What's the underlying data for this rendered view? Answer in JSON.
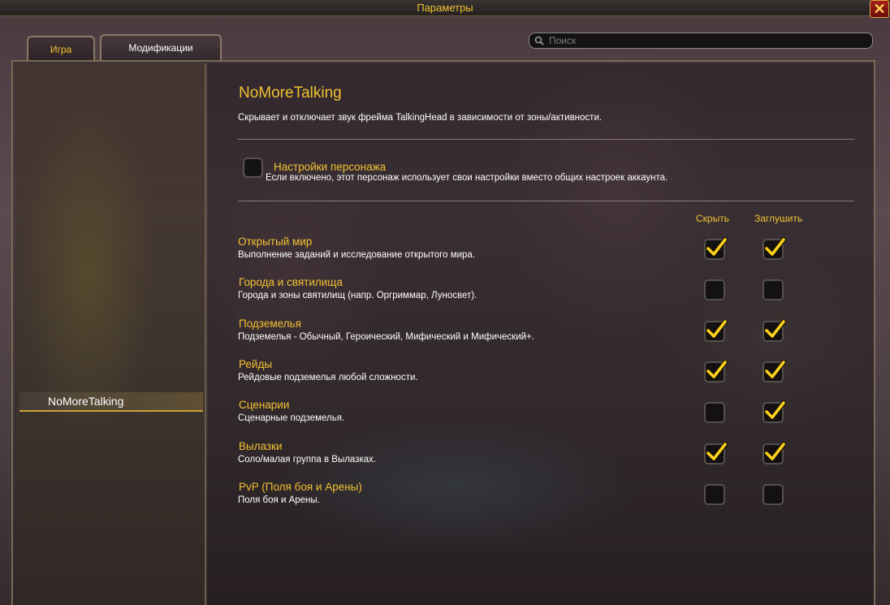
{
  "window": {
    "title": "Параметры",
    "close_label": "✕"
  },
  "tabs": [
    {
      "label": "Игра",
      "active": false
    },
    {
      "label": "Модификации",
      "active": true
    }
  ],
  "search": {
    "placeholder": "Поиск",
    "value": ""
  },
  "sidebar": {
    "items": [
      {
        "label": "NoMoreTalking",
        "selected": true
      }
    ]
  },
  "addon": {
    "title": "NoMoreTalking",
    "description": "Скрывает и отключает звук фрейма TalkingHead в зависимости от зоны/активности.",
    "character_settings": {
      "label": "Настройки персонажа",
      "description": "Если включено, этот персонаж использует свои настройки вместо общих настроек аккаунта.",
      "checked": false
    },
    "columns": {
      "hide": "Скрыть",
      "mute": "Заглушить"
    },
    "rows": [
      {
        "title": "Открытый мир",
        "description": "Выполнение заданий и исследование открытого мира.",
        "hide": true,
        "mute": true
      },
      {
        "title": "Города и святилища",
        "description": "Города и зоны святилищ (напр. Оргриммар, Луносвет).",
        "hide": false,
        "mute": false
      },
      {
        "title": "Подземелья",
        "description": "Подземелья - Обычный, Героический, Мифический и Мифический+.",
        "hide": true,
        "mute": true
      },
      {
        "title": "Рейды",
        "description": "Рейдовые подземелья любой сложности.",
        "hide": true,
        "mute": true
      },
      {
        "title": "Сценарии",
        "description": "Сценарные подземелья.",
        "hide": false,
        "mute": true
      },
      {
        "title": "Вылазки",
        "description": "Соло/малая группа в Вылазках.",
        "hide": true,
        "mute": true
      },
      {
        "title": "PvP (Поля боя и Арены)",
        "description": "Поля боя и Арены.",
        "hide": false,
        "mute": false
      }
    ]
  },
  "colors": {
    "accent_gold": "#f1c232",
    "text_white": "#ffffff",
    "check_yellow": "#ffd21f"
  }
}
